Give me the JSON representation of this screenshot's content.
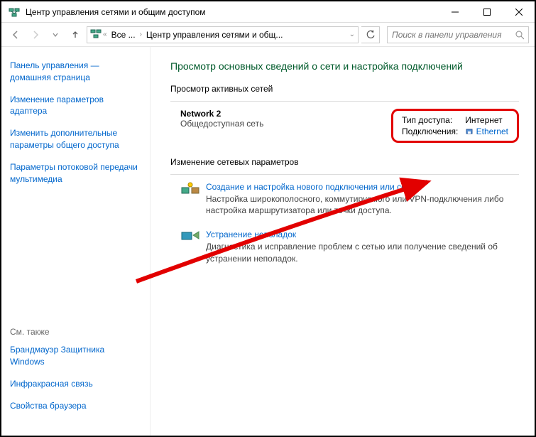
{
  "window": {
    "title": "Центр управления сетями и общим доступом"
  },
  "breadcrumb": {
    "item1": "Все ...",
    "item2": "Центр управления сетями и общ..."
  },
  "search": {
    "placeholder": "Поиск в панели управления"
  },
  "sidebar": {
    "link1": "Панель управления — домашняя страница",
    "link2": "Изменение параметров адаптера",
    "link3": "Изменить дополнительные параметры общего доступа",
    "link4": "Параметры потоковой передачи мультимедиа",
    "see_also": "См. также",
    "link5": "Брандмауэр Защитника Windows",
    "link6": "Инфракрасная связь",
    "link7": "Свойства браузера"
  },
  "main": {
    "heading": "Просмотр основных сведений о сети и настройка подключений",
    "section_active": "Просмотр активных сетей",
    "network": {
      "name": "Network 2",
      "type": "Общедоступная сеть",
      "access_label": "Тип доступа:",
      "access_value": "Интернет",
      "conn_label": "Подключения:",
      "conn_value": "Ethernet"
    },
    "section_change": "Изменение сетевых параметров",
    "task1": {
      "title": "Создание и настройка нового подключения или сети",
      "desc": "Настройка широкополосного, коммутируемого или VPN-подключения либо настройка маршрутизатора или точки доступа."
    },
    "task2": {
      "title": "Устранение неполадок",
      "desc": "Диагностика и исправление проблем с сетью или получение сведений об устранении неполадок."
    }
  }
}
